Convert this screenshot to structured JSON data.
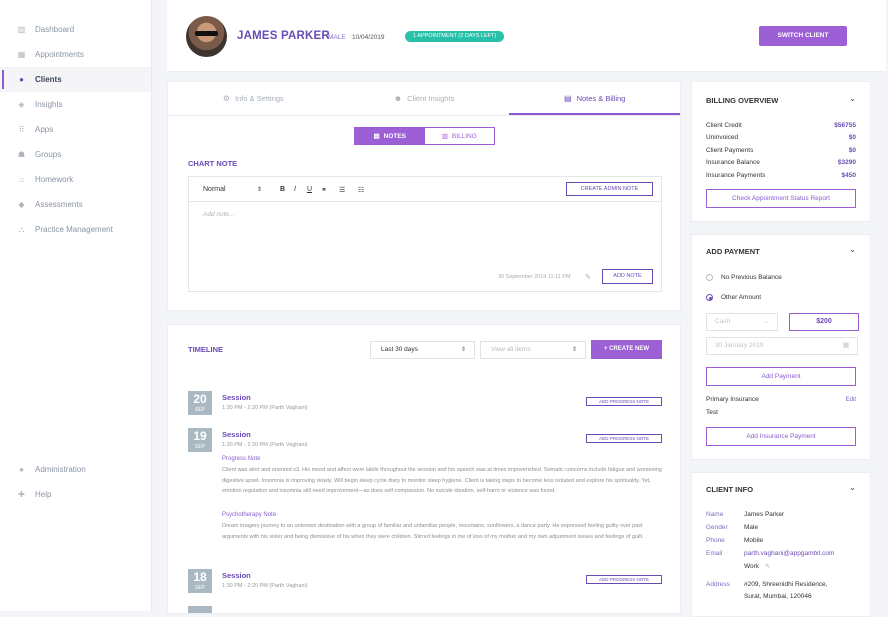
{
  "sidebar": {
    "items": [
      {
        "label": "Dashboard",
        "icon": "chart-icon"
      },
      {
        "label": "Appointments",
        "icon": "calendar-icon"
      },
      {
        "label": "Clients",
        "icon": "user-icon"
      },
      {
        "label": "Insights",
        "icon": "insights-icon"
      },
      {
        "label": "Apps",
        "icon": "grid-icon"
      },
      {
        "label": "Groups",
        "icon": "group-icon"
      },
      {
        "label": "Homework",
        "icon": "homework-icon"
      },
      {
        "label": "Assessments",
        "icon": "tag-icon"
      },
      {
        "label": "Practice Management",
        "icon": "org-icon"
      }
    ],
    "bottom": [
      {
        "label": "Administration",
        "icon": "admin-icon"
      },
      {
        "label": "Help",
        "icon": "help-icon"
      }
    ]
  },
  "header": {
    "name": "JAMES PARKER",
    "gender": "MALE",
    "dob": "10/04/2019",
    "badge": "1 APPOINTMENT (2 DAYS LEFT)",
    "switch": "SWITCH CLIENT"
  },
  "tabs": [
    "Info & Settings",
    "Client Insights",
    "Notes & Billing"
  ],
  "segment": {
    "notes": "NOTES",
    "billing": "BILLING"
  },
  "chart_note": {
    "title": "CHART NOTE",
    "format": "Normal",
    "admin_btn": "CREATE ADMIN NOTE",
    "placeholder": "Add note...",
    "timestamp": "30 September 2019 11:11 PM",
    "add_btn": "ADD NOTE"
  },
  "timeline": {
    "title": "TIMELINE",
    "range": "Last 30 days",
    "filter": "View all items",
    "create": "+ CREATE NEW",
    "items": [
      {
        "day": "20",
        "month": "SEP",
        "title": "Session",
        "time": "1:30 PM - 2:20 PM   (Parth Vaghani)",
        "btn": "ADD PROGRESS NOTE"
      },
      {
        "day": "19",
        "month": "SEP",
        "title": "Session",
        "time": "1:30 PM - 2:20 PM   (Parth Vaghani)",
        "btn": "ADD PROGRESS NOTE"
      },
      {
        "day": "18",
        "month": "SEP",
        "title": "Session",
        "time": "1:30 PM - 2:20 PM   (Parth Vaghani)",
        "btn": "ADD PROGRESS NOTE"
      }
    ],
    "progress_h": "Progress Note",
    "progress_p": "Client was alert and oriented x3. His mood and affect were labile throughout the session and his speech was at times impoverished. Somatic concerns include fatigue and worsening digestive upset. Insomnia is improving slowly. Will begin sleep cycle diary to monitor sleep hygiene. Client is taking steps to become less isolated and explore his spirituality. Yet, emotion regulation and insomnia still need improvement—as does self-compassion. No suicide ideation, self-harm or violence was found.",
    "psycho_h": "Psychotherapy Note",
    "psycho_p": "Dream imagery journey to an unknown destination with a group of familiar and unfamiliar people, mountains, sunflowers, a dance party. He expressed feeling guilty over past arguments with his sister and being dismissive of his when they were children. Stirred feelings in me of loss of my mother and my own adjustment issues and feelings of guilt."
  },
  "billing": {
    "title": "BILLING OVERVIEW",
    "rows": [
      {
        "k": "Client Credit",
        "v": "$56755"
      },
      {
        "k": "Uninvoiced",
        "v": "$0"
      },
      {
        "k": "Client Payments",
        "v": "$0"
      },
      {
        "k": "Insurance Balance",
        "v": "$3290"
      },
      {
        "k": "Insurance Payments",
        "v": "$450"
      }
    ],
    "btn": "Check Appointment Status Report"
  },
  "payment": {
    "title": "ADD PAYMENT",
    "opt1": "No Previous Balance",
    "opt2": "Other Amount",
    "method": "Cash",
    "amount": "$200",
    "date": "30 January 2019",
    "add_btn": "Add Payment",
    "insurance_label": "Primary Insurance",
    "edit": "Edit",
    "insurance_value": "Test",
    "ins_btn": "Add Insurance Payment"
  },
  "client_info": {
    "title": "CLIENT INFO",
    "name_k": "Name",
    "name_v": "James Parker",
    "gender_k": "Gender",
    "gender_v": "Male",
    "phone_k": "Phone",
    "phone_v": "Mobile",
    "email_k": "Email",
    "email_v": "parth.vaghani@appgambit.com",
    "email_type": "Work",
    "address_k": "Address",
    "address_v1": "#209, Shreenidhi Residence,",
    "address_v2": "Surat, Mumbai, 120046"
  },
  "colors": {
    "accent": "#9c5fd6",
    "brand": "#6a4bb5",
    "badge": "#28c0a8"
  }
}
